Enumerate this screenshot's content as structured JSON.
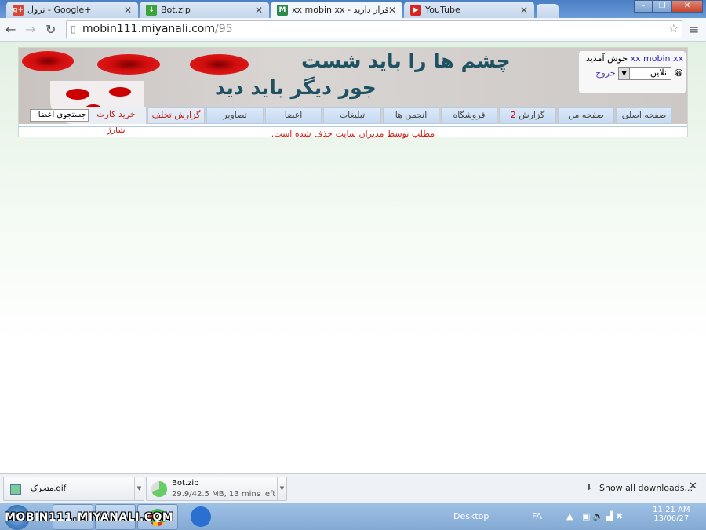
{
  "browser": {
    "tabs": [
      {
        "title": "ترول - Google+",
        "icon": "google-plus-icon",
        "active": false
      },
      {
        "title": "Bot.zip",
        "icon": "download-icon",
        "active": false
      },
      {
        "title": "xx mobin xx - در قرار دارید!",
        "icon": "miyanali-icon",
        "active": true
      },
      {
        "title": "YouTube",
        "icon": "youtube-icon",
        "active": false
      }
    ],
    "url_host": "mobin111.miyanali.com",
    "url_path": "/95"
  },
  "site": {
    "slogan_line1": "چشم ها را باید شست",
    "slogan_line2": "جور دیگر باید دید",
    "user": {
      "name": "xx mobin xx",
      "welcome": "خوش آمدید",
      "status": "آنلاین",
      "logout": "خروج"
    },
    "menu": [
      "صفحه اصلی",
      "صفحه من",
      "گزارش",
      "فروشگاه",
      "انجمن ها",
      "تبلیغات",
      "اعضا",
      "تصاویر",
      "گزارش تخلف",
      "خرید کارت شارژ"
    ],
    "report_count": "2",
    "search_placeholder": "جستجوی اعضا",
    "message": "مطلب توسط مدیران سایت حذف شده است."
  },
  "downloads": {
    "items": [
      {
        "name": "متحرک.gif",
        "status": ""
      },
      {
        "name": "Bot.zip",
        "status": "29.9/42.5 MB, 13 mins left"
      }
    ],
    "show_all": "Show all downloads..."
  },
  "taskbar": {
    "watermark": "MOBIN111.MIYANALI.COM",
    "desktop": "Desktop",
    "lang": "FA",
    "time": "11:21 AM",
    "date": "13/06/27"
  }
}
